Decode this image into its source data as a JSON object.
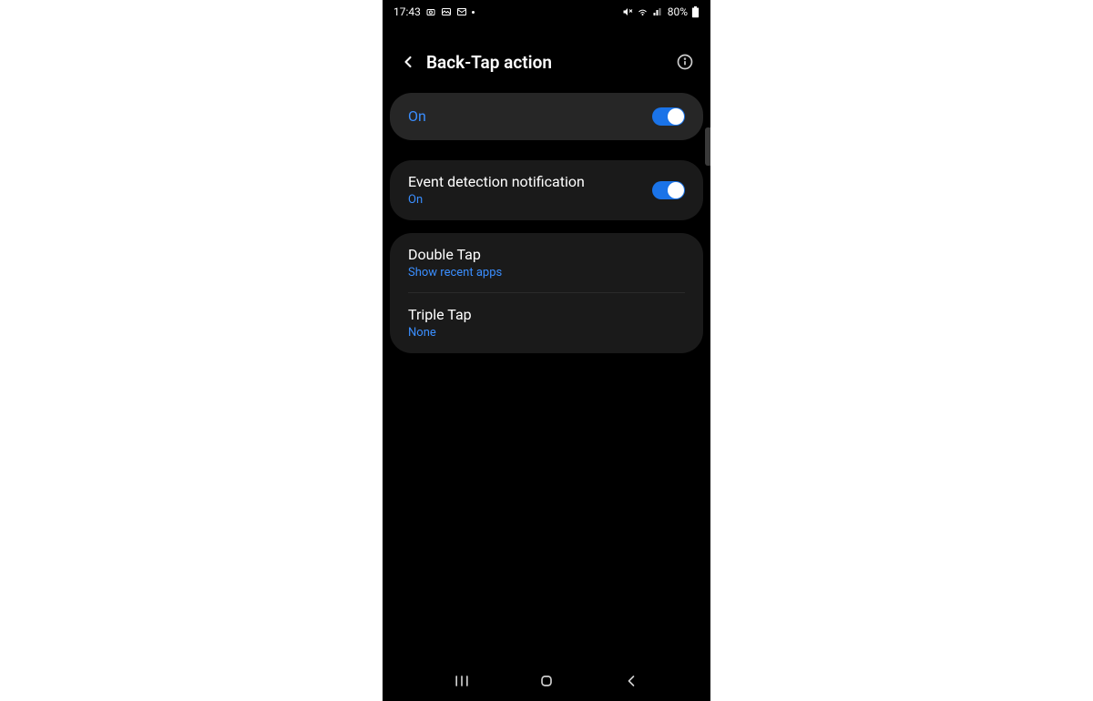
{
  "statusBar": {
    "time": "17:43",
    "battery": "80%"
  },
  "header": {
    "title": "Back-Tap action"
  },
  "master": {
    "label": "On",
    "enabled": true
  },
  "eventDetection": {
    "title": "Event detection notification",
    "sub": "On",
    "enabled": true
  },
  "doubleTap": {
    "title": "Double Tap",
    "sub": "Show recent apps"
  },
  "tripleTap": {
    "title": "Triple Tap",
    "sub": "None"
  },
  "colors": {
    "accent": "#3a8eff",
    "toggle": "#1a73e8",
    "cardBg": "#1a1a1a",
    "cardBgHighlight": "#262626"
  }
}
